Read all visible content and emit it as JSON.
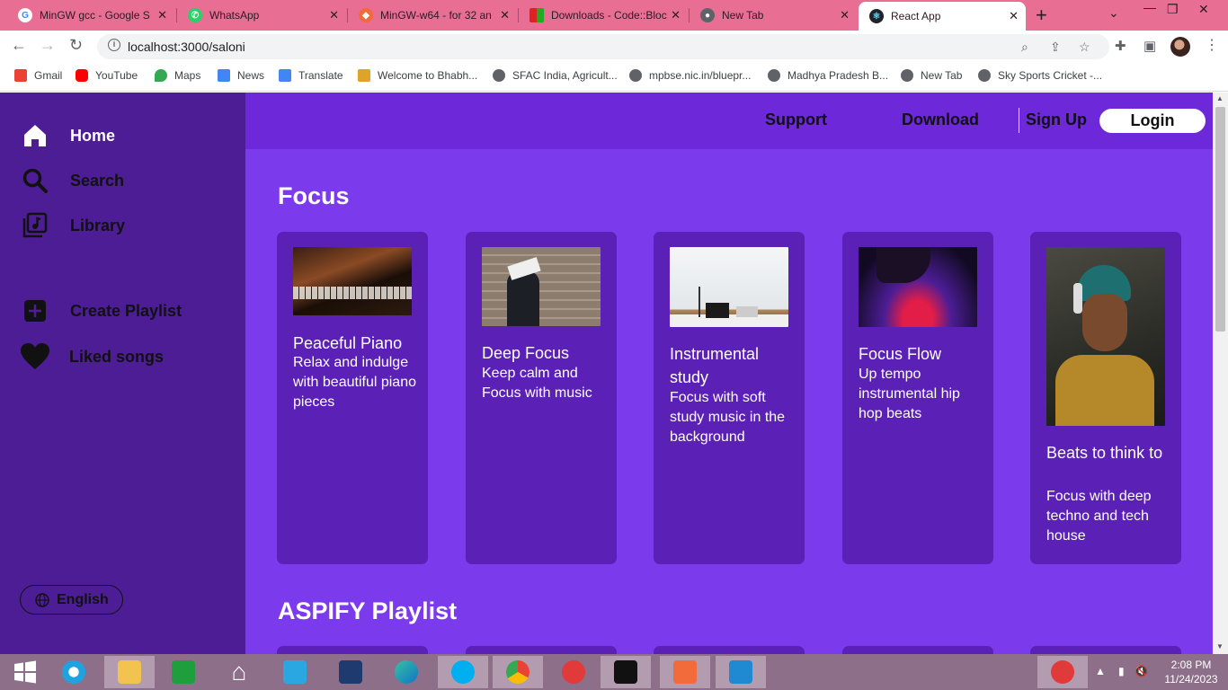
{
  "browser": {
    "tabs": [
      {
        "title": "MinGW gcc - Google S",
        "favicon": "google-icon",
        "color": "#4285f4"
      },
      {
        "title": "WhatsApp",
        "favicon": "whatsapp-icon",
        "color": "#25d366"
      },
      {
        "title": "MinGW-w64 - for 32 an",
        "favicon": "mingw-icon",
        "color": "#f26b3a"
      },
      {
        "title": "Downloads - Code::Bloc",
        "favicon": "codeblocks-icon",
        "color": "#d22"
      },
      {
        "title": "New Tab",
        "favicon": "chrome-icon",
        "color": "#5f6368"
      },
      {
        "title": "React App",
        "favicon": "react-icon",
        "color": "#61dafb"
      }
    ],
    "url": "localhost:3000/saloni",
    "bookmarks": [
      {
        "label": "Gmail",
        "icon": "gmail-icon",
        "color": "#ea4335"
      },
      {
        "label": "YouTube",
        "icon": "youtube-icon",
        "color": "#ff0000"
      },
      {
        "label": "Maps",
        "icon": "maps-icon",
        "color": "#34a853"
      },
      {
        "label": "News",
        "icon": "news-icon",
        "color": "#4285f4"
      },
      {
        "label": "Translate",
        "icon": "translate-icon",
        "color": "#4285f4"
      },
      {
        "label": "Welcome to Bhabh...",
        "icon": "crown-icon",
        "color": "#e1a22a"
      },
      {
        "label": "SFAC India, Agricult...",
        "icon": "globe-icon",
        "color": "#5f6368"
      },
      {
        "label": "mpbse.nic.in/bluepr...",
        "icon": "globe-icon",
        "color": "#5f6368"
      },
      {
        "label": "Madhya Pradesh B...",
        "icon": "globe-icon",
        "color": "#5f6368"
      },
      {
        "label": "New Tab",
        "icon": "globe-icon",
        "color": "#5f6368"
      },
      {
        "label": "Sky Sports Cricket -...",
        "icon": "globe-icon",
        "color": "#5f6368"
      }
    ]
  },
  "sidebar": {
    "items": [
      {
        "label": "Home",
        "icon": "home-icon"
      },
      {
        "label": "Search",
        "icon": "search-icon"
      },
      {
        "label": "Library",
        "icon": "library-icon"
      },
      {
        "label": "Create Playlist",
        "icon": "plus-square-icon"
      },
      {
        "label": "Liked songs",
        "icon": "heart-icon"
      }
    ],
    "language": "English"
  },
  "topnav": {
    "support": "Support",
    "download": "Download",
    "signup": "Sign Up",
    "login": "Login"
  },
  "sections": [
    {
      "title": "Focus",
      "cards": [
        {
          "title": "Peaceful Piano",
          "desc": "Relax and indulge with beautiful piano pieces",
          "image": "piano-photo"
        },
        {
          "title": "Deep Focus",
          "desc": "Keep calm and Focus with music",
          "image": "book-face-photo"
        },
        {
          "title": "Instrumental study",
          "desc": "Focus with soft study music in the background",
          "image": "desk-photo"
        },
        {
          "title": "Focus Flow",
          "desc": "Up tempo instrumental hip hop beats",
          "image": "dj-deck-photo"
        },
        {
          "title": "Beats to think to",
          "desc": "Focus with deep techno and tech house",
          "image": "headphones-photo"
        }
      ]
    },
    {
      "title": "ASPIFY Playlist"
    }
  ],
  "taskbar": {
    "time": "2:08 PM",
    "date": "11/24/2023"
  },
  "colors": {
    "sidebar": "#4c1d95",
    "main": "#7c3aed",
    "topnav": "#6d28d9",
    "card": "#5b21b6",
    "tabbar": "#e86e94"
  }
}
